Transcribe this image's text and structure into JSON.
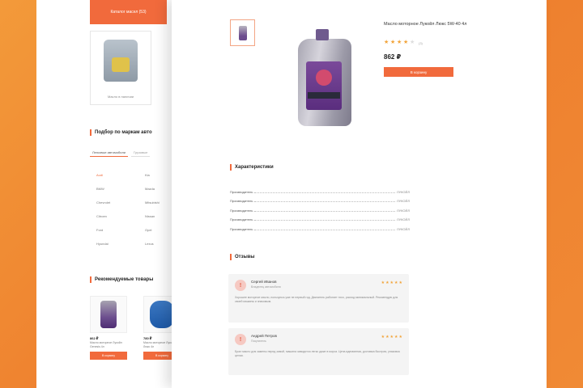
{
  "back_page": {
    "header_label": "Каталог масел (53)",
    "product_caption": "Масло в наличии",
    "brand_section_title": "Подбор по маркам авто",
    "tabs": [
      "Легковые автомобили",
      "Грузовые"
    ],
    "brands": [
      [
        "Audi",
        "Kia"
      ],
      [
        "BMW",
        "Mazda"
      ],
      [
        "Chevrolet",
        "Mitsubishi"
      ],
      [
        "Citroen",
        "Nissan"
      ],
      [
        "Ford",
        "Opel"
      ],
      [
        "Hyundai",
        "Lexus"
      ]
    ],
    "rec_section_title": "Рекомендуемые товары",
    "rec_items": [
      {
        "price": "862 ₽",
        "desc": "Масло моторное Лукойл Genesis 4л",
        "button": "В корзину",
        "image": "purple-bottle"
      },
      {
        "price": "780 ₽",
        "desc": "Масло моторное Лукойл Люкс 4л",
        "button": "В корзину",
        "image": "blue-bottle"
      }
    ]
  },
  "product": {
    "title": "Масло моторное Лукойл Люкс 5W-40 4л",
    "rating": 4,
    "rating_max": 5,
    "rating_count": "(3)",
    "price": "862 ₽",
    "buy_label": "В корзину"
  },
  "specs": {
    "title": "Характеристики",
    "rows": [
      {
        "key": "Производитель",
        "val": "ЛУКОЙЛ"
      },
      {
        "key": "Производитель",
        "val": "ЛУКОЙЛ"
      },
      {
        "key": "Производитель",
        "val": "ЛУКОЙЛ"
      },
      {
        "key": "Производитель",
        "val": "ЛУКОЙЛ"
      },
      {
        "key": "Производитель",
        "val": "ЛУКОЙЛ"
      }
    ]
  },
  "reviews": {
    "title": "Отзывы",
    "items": [
      {
        "avatar_letter": "!",
        "name": "Сергей Иванов",
        "date": "Владелец автомобиля",
        "rating": 5,
        "text": "Хорошее моторное масло, пользуюсь уже не первый год. Двигатель работает тихо, расход минимальный. Рекомендую для своей машины и знакомым."
      },
      {
        "avatar_letter": "!",
        "name": "Андрей Петров",
        "date": "Покупатель",
        "rating": 5,
        "text": "Брал масло для замены перед зимой, машина заводится легко даже в мороз. Цена адекватная, доставка быстрая, упаковка целая."
      }
    ]
  },
  "colors": {
    "accent": "#f16a3c",
    "star": "#f2a43a",
    "background_orange": "#ee7f2e"
  }
}
